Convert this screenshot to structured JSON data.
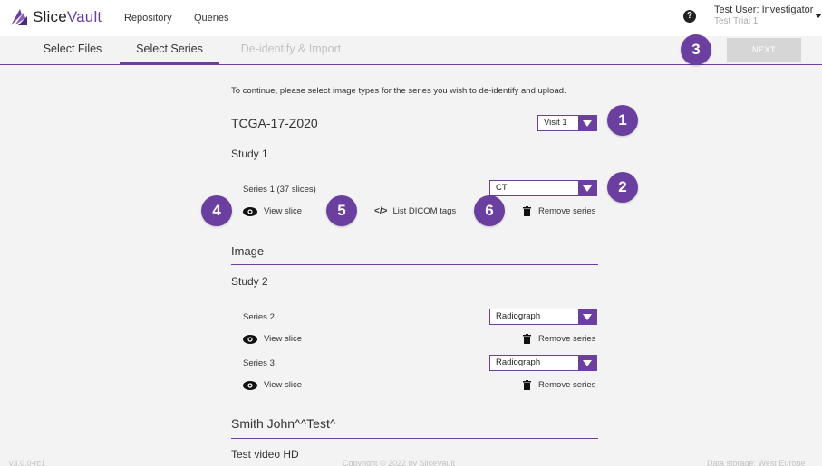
{
  "app": {
    "name_part1": "Slice",
    "name_part2": "Vault"
  },
  "nav": {
    "links": [
      "Repository",
      "Queries"
    ]
  },
  "user": {
    "name": "Test User: Investigator",
    "trial": "Test Trial 1"
  },
  "tabs": [
    {
      "label": "Select Files",
      "state": "normal"
    },
    {
      "label": "Select Series",
      "state": "active"
    },
    {
      "label": "De-identify & Import",
      "state": "disabled"
    }
  ],
  "next_button": "NEXT",
  "instructions": "To continue, please select image types for the series you wish to de-identify and upload.",
  "callouts": [
    "1",
    "2",
    "3",
    "4",
    "5",
    "6"
  ],
  "patients": [
    {
      "name": "TCGA-17-Z020",
      "visit_select": "Visit 1",
      "studies": [
        {
          "name": "Study 1",
          "series": [
            {
              "label": "Series 1 (37 slices)",
              "type": "CT",
              "view": "View slice",
              "dicom": "List DICOM tags",
              "remove": "Remove series"
            }
          ]
        },
        {
          "name": "Image",
          "series": []
        },
        {
          "name": "Study 2",
          "series": [
            {
              "label": "Series 2",
              "type": "Radiograph",
              "view": "View slice",
              "remove": "Remove series"
            },
            {
              "label": "Series 3",
              "type": "Radiograph",
              "view": "View slice",
              "remove": "Remove series"
            }
          ]
        }
      ]
    },
    {
      "name": "Smith John^^Test^",
      "studies": [
        {
          "name": "Test video HD",
          "series": []
        }
      ]
    }
  ],
  "footer": {
    "version": "v3.0.0-rc1",
    "copyright": "Copyright © 2022 by SliceVault",
    "storage": "Data storage: West Europe"
  },
  "colors": {
    "accent": "#6b3fa0",
    "disabled": "#c2c2c2",
    "background": "#f3f3f3"
  },
  "icons": {
    "logo": "slicevault-logo-icon",
    "help": "question-circle-icon",
    "caret": "caret-down-icon",
    "eye": "eye-icon",
    "code": "code-icon",
    "trash": "trash-icon"
  }
}
